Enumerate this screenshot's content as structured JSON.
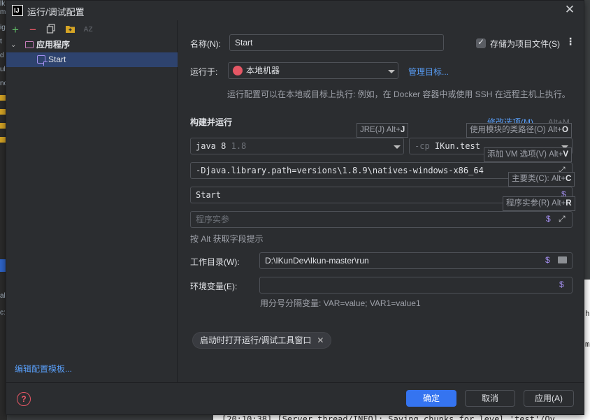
{
  "background": {
    "left_fragments": [
      "lk",
      "m",
      "ig",
      "t",
      "d",
      "ul",
      "no",
      "al",
      "c:s"
    ],
    "console_line": "[20:10:38] [Server thread/INFO]: Saving chunks for level 'test'/Ov",
    "right_fragments": [
      "h",
      "m"
    ]
  },
  "dialog": {
    "title": "运行/调试配置",
    "close_icon": "close-icon"
  },
  "sidebar": {
    "toolbar": [
      "add-icon",
      "remove-icon",
      "copy-icon",
      "folder-icon",
      "sort-icon"
    ],
    "tree": [
      {
        "label": "应用程序",
        "icon": "application-folder-icon",
        "expanded": true
      },
      {
        "label": "Start",
        "icon": "run-config-icon",
        "selected": true
      }
    ],
    "edit_templates": "编辑配置模板..."
  },
  "form": {
    "name_label": "名称(N):",
    "name_value": "Start",
    "store_as_project": "存储为项目文件(S)",
    "store_checked": true,
    "run_on_label": "运行于:",
    "run_on_value": "本地机器",
    "manage_targets": "管理目标...",
    "run_on_hint": "运行配置可以在本地或目标上执行: 例如，在 Docker 容器中或使用 SSH 在远程主机上执行。",
    "build_run_title": "构建并运行",
    "modify_options": "修改选项(M)",
    "modify_shortcut": "Alt+M",
    "jre_value": "java 8",
    "jre_version": "1.8",
    "cp_prefix": "-cp",
    "cp_value": "IKun.test",
    "vm_options": "-Djava.library.path=versions\\1.8.9\\natives-windows-x86_64",
    "main_class": "Start",
    "program_args_placeholder": "程序实参",
    "alt_hint": "按 Alt 获取字段提示",
    "workdir_label": "工作目录(W):",
    "workdir_value": "D:\\IKunDev\\Ikun-master\\run",
    "env_label": "环境变量(E):",
    "env_value": "",
    "env_hint": "用分号分隔变量: VAR=value; VAR1=value1",
    "launch_chip": "启动时打开运行/调试工具窗口"
  },
  "tooltips": {
    "jre": {
      "text": "JRE(J) Alt+",
      "key": "J"
    },
    "classpath": {
      "text": "使用模块的类路径(O) Alt+",
      "key": "O"
    },
    "vm": {
      "text": "添加 VM 选项(V) Alt+",
      "key": "V"
    },
    "main": {
      "text": "主要类(C): Alt+",
      "key": "C"
    },
    "args": {
      "text": "程序实参(R) Alt+",
      "key": "R"
    }
  },
  "buttons": {
    "ok": "确定",
    "cancel": "取消",
    "apply": "应用(A)"
  },
  "colors": {
    "accent": "#3574f0",
    "link": "#589df6",
    "macro": "#a48ff0",
    "help": "#e55765"
  }
}
